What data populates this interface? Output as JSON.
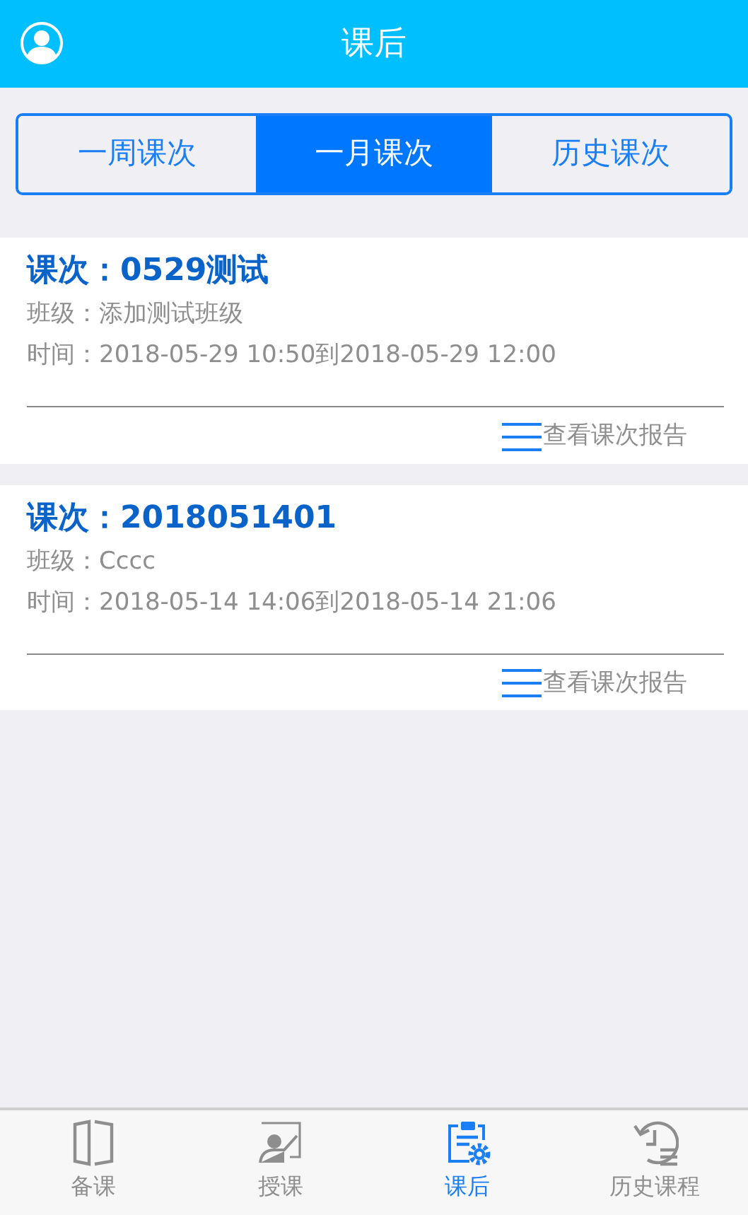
{
  "header": {
    "title": "课后"
  },
  "tabs": [
    {
      "label": "一周课次",
      "selected": false
    },
    {
      "label": "一月课次",
      "selected": true
    },
    {
      "label": "历史课次",
      "selected": false
    }
  ],
  "lessons": [
    {
      "title": "课次：0529测试",
      "class": "班级：添加测试班级",
      "time": "时间：2018-05-29 10:50到2018-05-29 12:00",
      "link": "查看课次报告"
    },
    {
      "title": "课次：2018051401",
      "class": "班级：Cccc",
      "time": "时间：2018-05-14 14:06到2018-05-14 21:06",
      "link": "查看课次报告"
    }
  ],
  "bottom_nav": [
    {
      "kind": "book",
      "label": "备课",
      "selected": false
    },
    {
      "kind": "teach",
      "label": "授课",
      "selected": false
    },
    {
      "kind": "clipboard",
      "label": "课后",
      "selected": true
    },
    {
      "kind": "history",
      "label": "历史课程",
      "selected": false
    }
  ]
}
